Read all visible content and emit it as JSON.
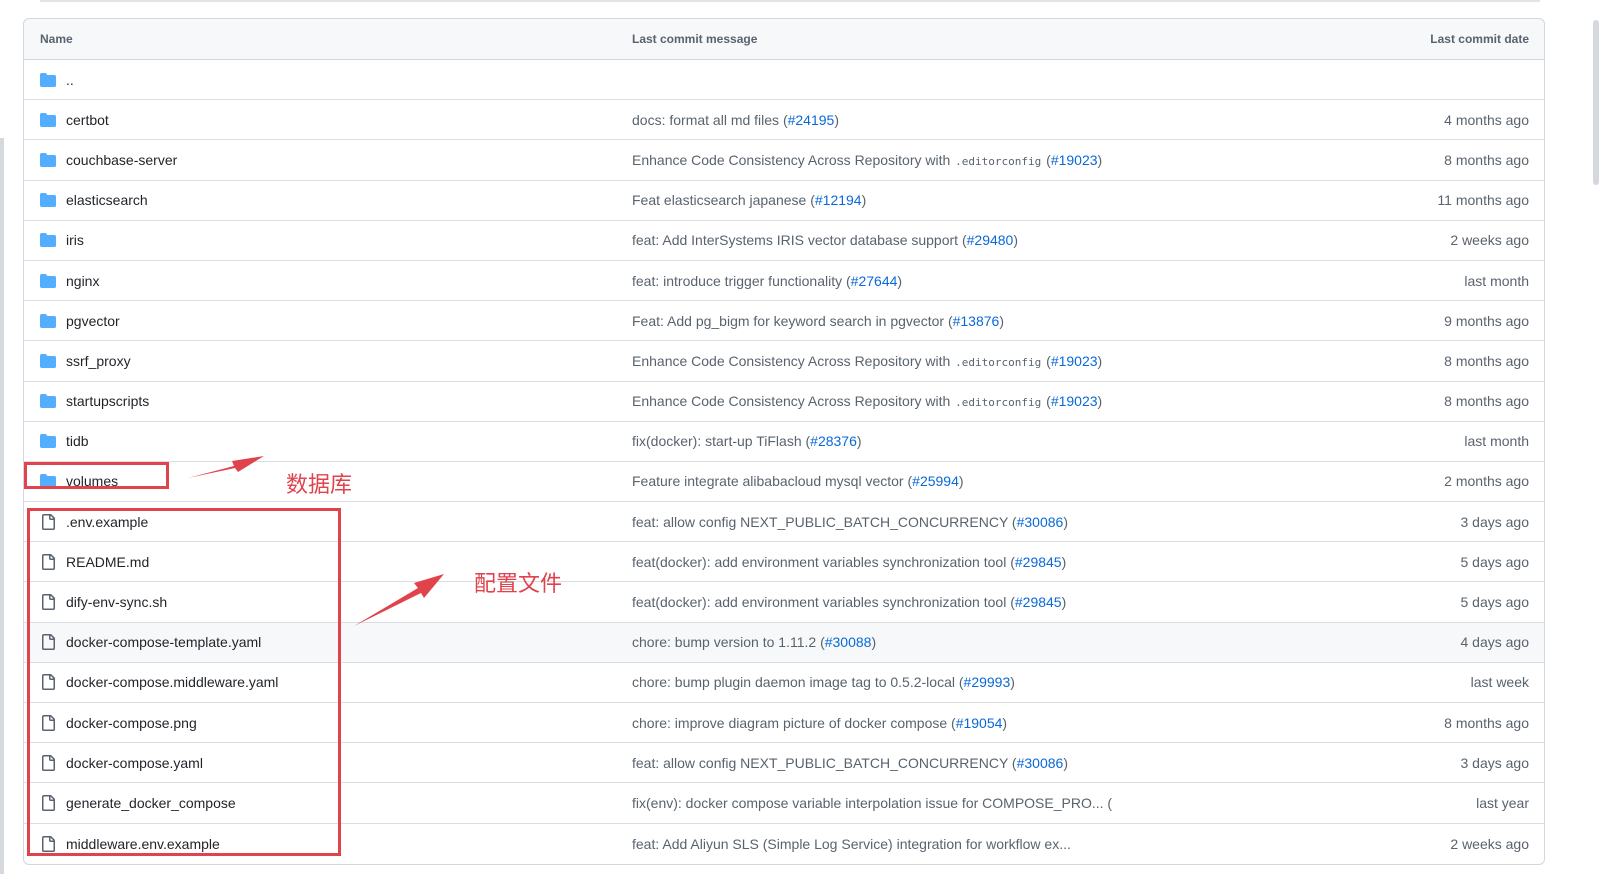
{
  "table": {
    "headers": {
      "name": "Name",
      "message": "Last commit message",
      "date": "Last commit date"
    },
    "parent_dir": "..",
    "rows": [
      {
        "type": "folder",
        "name": "certbot",
        "msg_pre": "docs: format all md files (",
        "pr": "#24195",
        "msg_post": ")",
        "date": "4 months ago"
      },
      {
        "type": "folder",
        "name": "couchbase-server",
        "msg_pre": "Enhance Code Consistency Across Repository with ",
        "code": ".editorconfig",
        "msg_mid": " (",
        "pr": "#19023",
        "msg_post": ")",
        "date": "8 months ago"
      },
      {
        "type": "folder",
        "name": "elasticsearch",
        "msg_pre": "Feat elasticsearch japanese (",
        "pr": "#12194",
        "msg_post": ")",
        "date": "11 months ago"
      },
      {
        "type": "folder",
        "name": "iris",
        "msg_pre": "feat: Add InterSystems IRIS vector database support (",
        "pr": "#29480",
        "msg_post": ")",
        "date": "2 weeks ago"
      },
      {
        "type": "folder",
        "name": "nginx",
        "msg_pre": "feat: introduce trigger functionality (",
        "pr": "#27644",
        "msg_post": ")",
        "date": "last month"
      },
      {
        "type": "folder",
        "name": "pgvector",
        "msg_pre": "Feat: Add pg_bigm for keyword search in pgvector (",
        "pr": "#13876",
        "msg_post": ")",
        "date": "9 months ago"
      },
      {
        "type": "folder",
        "name": "ssrf_proxy",
        "msg_pre": "Enhance Code Consistency Across Repository with ",
        "code": ".editorconfig",
        "msg_mid": " (",
        "pr": "#19023",
        "msg_post": ")",
        "date": "8 months ago"
      },
      {
        "type": "folder",
        "name": "startupscripts",
        "msg_pre": "Enhance Code Consistency Across Repository with ",
        "code": ".editorconfig",
        "msg_mid": " (",
        "pr": "#19023",
        "msg_post": ")",
        "date": "8 months ago"
      },
      {
        "type": "folder",
        "name": "tidb",
        "msg_pre": "fix(docker): start-up TiFlash (",
        "pr": "#28376",
        "msg_post": ")",
        "date": "last month"
      },
      {
        "type": "folder",
        "name": "volumes",
        "msg_pre": "Feature integrate alibabacloud mysql vector (",
        "pr": "#25994",
        "msg_post": ")",
        "date": "2 months ago"
      },
      {
        "type": "file",
        "name": ".env.example",
        "msg_pre": "feat: allow config NEXT_PUBLIC_BATCH_CONCURRENCY (",
        "pr": "#30086",
        "msg_post": ")",
        "date": "3 days ago"
      },
      {
        "type": "file",
        "name": "README.md",
        "msg_pre": "feat(docker): add environment variables synchronization tool (",
        "pr": "#29845",
        "msg_post": ")",
        "date": "5 days ago"
      },
      {
        "type": "file",
        "name": "dify-env-sync.sh",
        "msg_pre": "feat(docker): add environment variables synchronization tool (",
        "pr": "#29845",
        "msg_post": ")",
        "date": "5 days ago"
      },
      {
        "type": "file",
        "name": "docker-compose-template.yaml",
        "msg_pre": "chore: bump version to 1.11.2 (",
        "pr": "#30088",
        "msg_post": ")",
        "date": "4 days ago",
        "hover": true
      },
      {
        "type": "file",
        "name": "docker-compose.middleware.yaml",
        "msg_pre": "chore: bump plugin daemon image tag to 0.5.2-local (",
        "pr": "#29993",
        "msg_post": ")",
        "date": "last week"
      },
      {
        "type": "file",
        "name": "docker-compose.png",
        "msg_pre": "chore: improve diagram picture of docker compose (",
        "pr": "#19054",
        "msg_post": ")",
        "date": "8 months ago"
      },
      {
        "type": "file",
        "name": "docker-compose.yaml",
        "msg_pre": "feat: allow config NEXT_PUBLIC_BATCH_CONCURRENCY (",
        "pr": "#30086",
        "msg_post": ")",
        "date": "3 days ago"
      },
      {
        "type": "file",
        "name": "generate_docker_compose",
        "msg_pre": "fix(env): docker compose variable interpolation issue for COMPOSE_PRO... (",
        "pr": "",
        "msg_post": "",
        "date": "last year"
      },
      {
        "type": "file",
        "name": "middleware.env.example",
        "msg_pre": "feat: Add Aliyun SLS (Simple Log Service) integration for workflow ex...",
        "pr": "",
        "msg_post": "",
        "date": "2 weeks ago"
      }
    ]
  },
  "annotations": {
    "database_label": "数据库",
    "config_label": "配置文件",
    "color": "#e0434b"
  },
  "colors": {
    "folder_icon": "#54aeff",
    "link": "#0969da"
  }
}
